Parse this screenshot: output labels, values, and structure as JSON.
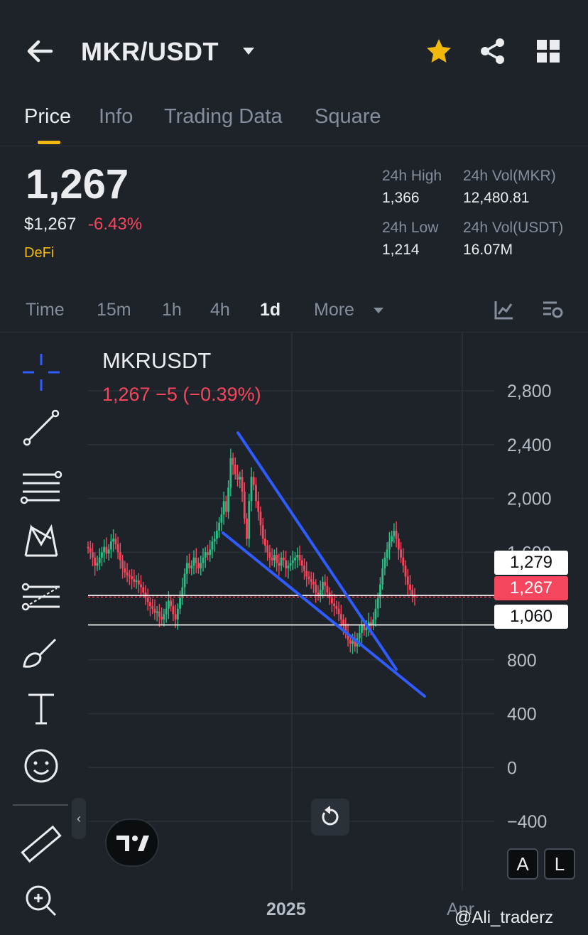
{
  "header": {
    "pair": "MKR/USDT",
    "icons": [
      "back-arrow-icon",
      "caret-down-icon",
      "star-icon",
      "share-icon",
      "grid-icon"
    ],
    "star_color": "#f0b90b"
  },
  "tabs": [
    {
      "label": "Price",
      "active": true
    },
    {
      "label": "Info",
      "active": false
    },
    {
      "label": "Trading Data",
      "active": false
    },
    {
      "label": "Square",
      "active": false
    }
  ],
  "ticker": {
    "last_price": "1,267",
    "usd_price": "$1,267",
    "change_pct": "-6.43%",
    "tag": "DeFi",
    "high_label": "24h High",
    "high": "1,366",
    "low_label": "24h Low",
    "low": "1,214",
    "vol_base_label": "24h Vol(MKR)",
    "vol_base": "12,480.81",
    "vol_quote_label": "24h Vol(USDT)",
    "vol_quote": "16.07M"
  },
  "timeframes": [
    {
      "label": "Time",
      "active": false
    },
    {
      "label": "15m",
      "active": false
    },
    {
      "label": "1h",
      "active": false
    },
    {
      "label": "4h",
      "active": false
    },
    {
      "label": "1d",
      "active": true
    },
    {
      "label": "More",
      "active": false
    }
  ],
  "chart": {
    "symbol": "MKRUSDT",
    "info": "1,267  −5 (−0.39%)",
    "price_labels": {
      "upper": "1,279",
      "current": "1,267",
      "lower": "1,060"
    },
    "y_ticks": [
      "2,800",
      "2,400",
      "2,000",
      "1,600",
      "800",
      "400",
      "0",
      "-400"
    ],
    "x_year": "2025",
    "x_month": "Apr",
    "axis_buttons": [
      "A",
      "L"
    ],
    "watermark": "@Ali_traderz",
    "up_color": "#2ebd85",
    "down_color": "#f6465d",
    "trendline_color": "#2f5bff"
  },
  "chart_data": {
    "type": "candlestick",
    "title": "MKRUSDT",
    "ylim": [
      -600,
      3000
    ],
    "y_ticks": [
      2800,
      2400,
      2000,
      1600,
      800,
      400,
      0,
      -400
    ],
    "x_labels": [
      "2025",
      "Apr"
    ],
    "horizontal_lines": [
      1279,
      1060
    ],
    "current_price": 1267,
    "close_series": [
      1630,
      1600,
      1560,
      1500,
      1520,
      1560,
      1600,
      1640,
      1590,
      1620,
      1680,
      1700,
      1660,
      1600,
      1540,
      1480,
      1450,
      1430,
      1420,
      1400,
      1380,
      1390,
      1360,
      1340,
      1300,
      1260,
      1230,
      1200,
      1180,
      1150,
      1160,
      1120,
      1100,
      1140,
      1180,
      1240,
      1200,
      1140,
      1100,
      1180,
      1260,
      1340,
      1440,
      1520,
      1480,
      1500,
      1560,
      1520,
      1480,
      1520,
      1560,
      1600,
      1580,
      1620,
      1680,
      1700,
      1760,
      1820,
      1880,
      1980,
      1900,
      2080,
      2300,
      2250,
      2180,
      2140,
      2160,
      2050,
      1850,
      1700,
      1980,
      2160,
      2100,
      1980,
      1900,
      1800,
      1700,
      1650,
      1600,
      1560,
      1540,
      1580,
      1520,
      1500,
      1560,
      1540,
      1480,
      1500,
      1520,
      1540,
      1560,
      1580,
      1540,
      1500,
      1460,
      1420,
      1400,
      1380,
      1360,
      1300,
      1280,
      1320,
      1380,
      1350,
      1300,
      1260,
      1220,
      1200,
      1180,
      1140,
      1100,
      1060,
      1000,
      950,
      920,
      940,
      900,
      960,
      1000,
      1060,
      1020,
      1040,
      1080,
      1060,
      1100,
      1180,
      1260,
      1360,
      1480,
      1560,
      1620,
      1680,
      1720,
      1760,
      1700,
      1620,
      1560,
      1500,
      1420,
      1360,
      1320,
      1280,
      1267
    ]
  }
}
